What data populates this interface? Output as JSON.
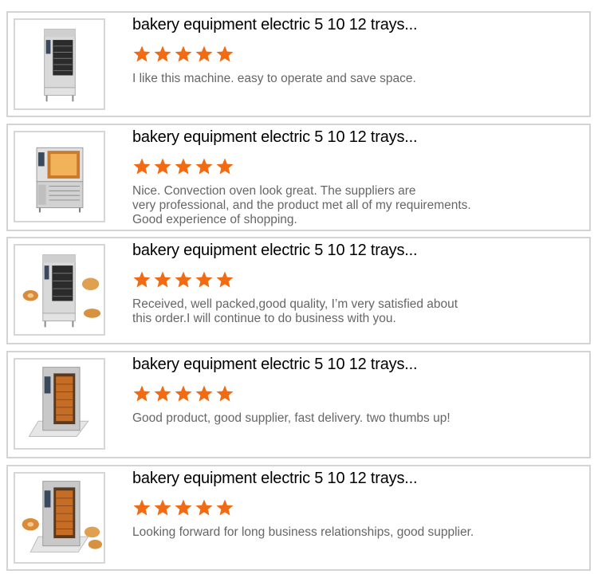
{
  "accent_color": "#f26a12",
  "reviews": [
    {
      "title": "bakery equipment electric 5 10 12 trays...",
      "rating": 5,
      "rating_max": 5,
      "image": "oven-product-photo",
      "comment": "I like this machine. easy to operate and save space."
    },
    {
      "title": "bakery equipment electric 5 10 12 trays...",
      "rating": 5,
      "rating_max": 5,
      "image": "oven-product-photo",
      "comment": "Nice. Convection oven look great. The suppliers are\nvery professional, and the product met all of my requirements.\nGood experience of shopping."
    },
    {
      "title": "bakery equipment electric 5 10 12 trays...",
      "rating": 5,
      "rating_max": 5,
      "image": "oven-with-bread-photo",
      "comment": "Received, well packed,good quality, I’m very satisfied about\nthis order.I will continue to do business with you."
    },
    {
      "title": "bakery equipment electric 5 10 12 trays...",
      "rating": 5,
      "rating_max": 5,
      "image": "rotary-oven-photo",
      "comment": "Good product, good supplier, fast delivery. two thumbs up!"
    },
    {
      "title": "bakery equipment electric 5 10 12 trays...",
      "rating": 5,
      "rating_max": 5,
      "image": "rotary-oven-with-bread-photo",
      "comment": "Looking forward for long business relationships, good supplier."
    }
  ]
}
